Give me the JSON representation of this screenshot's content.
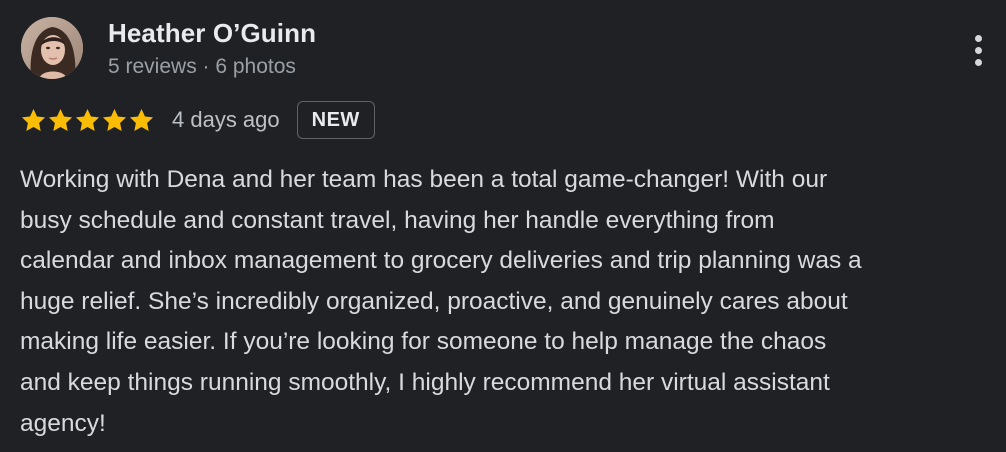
{
  "reviewer": {
    "name": "Heather O’Guinn",
    "meta": "5 reviews · 6 photos",
    "avatar_icon": "avatar-photo"
  },
  "menu": {
    "icon": "more-vertical-icon"
  },
  "rating": {
    "stars": 5,
    "max_stars": 5,
    "star_color": "#fbbc04",
    "date": "4 days ago",
    "badge": "NEW"
  },
  "review": {
    "lines": [
      "Working with Dena and her team has been a total game-changer! With our",
      "busy schedule and constant travel, having her handle everything from",
      "calendar and inbox management to grocery deliveries and trip planning was a",
      "huge relief. She’s incredibly organized, proactive, and genuinely cares about",
      "making life easier. If you’re looking for someone to help manage the chaos",
      "and keep things running smoothly, I highly recommend her virtual assistant",
      "agency!"
    ]
  },
  "colors": {
    "background": "#202124",
    "primary_text": "#e8eaed",
    "secondary_text": "#9aa0a6",
    "body_text": "#d8dadd",
    "badge_border": "#5f6368"
  }
}
